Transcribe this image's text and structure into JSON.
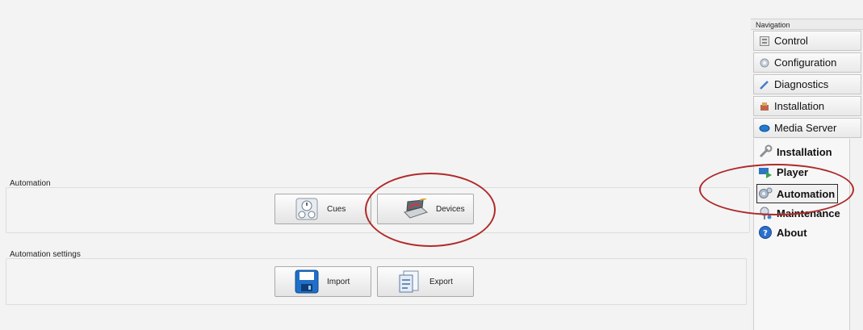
{
  "automation_group": {
    "label": "Automation",
    "buttons": {
      "cues": "Cues",
      "devices": "Devices"
    }
  },
  "settings_group": {
    "label": "Automation settings",
    "buttons": {
      "import": "Import",
      "export": "Export"
    }
  },
  "navigation": {
    "title": "Navigation",
    "items": [
      {
        "label": "Control",
        "icon": "control-icon"
      },
      {
        "label": "Configuration",
        "icon": "gear-icon"
      },
      {
        "label": "Diagnostics",
        "icon": "pen-icon"
      },
      {
        "label": "Installation",
        "icon": "installation-icon"
      },
      {
        "label": "Media Server",
        "icon": "disk-icon"
      }
    ],
    "sub_items": [
      {
        "label": "Installation",
        "icon": "wrench-icon"
      },
      {
        "label": "Player",
        "icon": "player-icon"
      },
      {
        "label": "Automation",
        "icon": "gears-icon",
        "selected": true
      },
      {
        "label": "Maintenance",
        "icon": "maintenance-icon"
      },
      {
        "label": "About",
        "icon": "info-icon"
      }
    ]
  },
  "colors": {
    "annotation": "#b02a2a",
    "accent": "#1e6fc9"
  }
}
